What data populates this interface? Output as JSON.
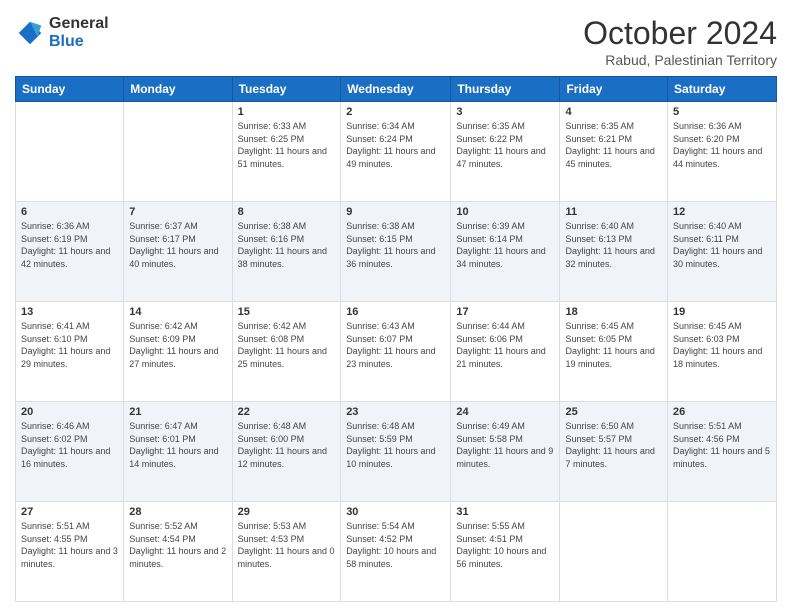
{
  "logo": {
    "general": "General",
    "blue": "Blue"
  },
  "header": {
    "month": "October 2024",
    "location": "Rabud, Palestinian Territory"
  },
  "weekdays": [
    "Sunday",
    "Monday",
    "Tuesday",
    "Wednesday",
    "Thursday",
    "Friday",
    "Saturday"
  ],
  "weeks": [
    [
      {
        "day": "",
        "sunrise": "",
        "sunset": "",
        "daylight": ""
      },
      {
        "day": "",
        "sunrise": "",
        "sunset": "",
        "daylight": ""
      },
      {
        "day": "1",
        "sunrise": "Sunrise: 6:33 AM",
        "sunset": "Sunset: 6:25 PM",
        "daylight": "Daylight: 11 hours and 51 minutes."
      },
      {
        "day": "2",
        "sunrise": "Sunrise: 6:34 AM",
        "sunset": "Sunset: 6:24 PM",
        "daylight": "Daylight: 11 hours and 49 minutes."
      },
      {
        "day": "3",
        "sunrise": "Sunrise: 6:35 AM",
        "sunset": "Sunset: 6:22 PM",
        "daylight": "Daylight: 11 hours and 47 minutes."
      },
      {
        "day": "4",
        "sunrise": "Sunrise: 6:35 AM",
        "sunset": "Sunset: 6:21 PM",
        "daylight": "Daylight: 11 hours and 45 minutes."
      },
      {
        "day": "5",
        "sunrise": "Sunrise: 6:36 AM",
        "sunset": "Sunset: 6:20 PM",
        "daylight": "Daylight: 11 hours and 44 minutes."
      }
    ],
    [
      {
        "day": "6",
        "sunrise": "Sunrise: 6:36 AM",
        "sunset": "Sunset: 6:19 PM",
        "daylight": "Daylight: 11 hours and 42 minutes."
      },
      {
        "day": "7",
        "sunrise": "Sunrise: 6:37 AM",
        "sunset": "Sunset: 6:17 PM",
        "daylight": "Daylight: 11 hours and 40 minutes."
      },
      {
        "day": "8",
        "sunrise": "Sunrise: 6:38 AM",
        "sunset": "Sunset: 6:16 PM",
        "daylight": "Daylight: 11 hours and 38 minutes."
      },
      {
        "day": "9",
        "sunrise": "Sunrise: 6:38 AM",
        "sunset": "Sunset: 6:15 PM",
        "daylight": "Daylight: 11 hours and 36 minutes."
      },
      {
        "day": "10",
        "sunrise": "Sunrise: 6:39 AM",
        "sunset": "Sunset: 6:14 PM",
        "daylight": "Daylight: 11 hours and 34 minutes."
      },
      {
        "day": "11",
        "sunrise": "Sunrise: 6:40 AM",
        "sunset": "Sunset: 6:13 PM",
        "daylight": "Daylight: 11 hours and 32 minutes."
      },
      {
        "day": "12",
        "sunrise": "Sunrise: 6:40 AM",
        "sunset": "Sunset: 6:11 PM",
        "daylight": "Daylight: 11 hours and 30 minutes."
      }
    ],
    [
      {
        "day": "13",
        "sunrise": "Sunrise: 6:41 AM",
        "sunset": "Sunset: 6:10 PM",
        "daylight": "Daylight: 11 hours and 29 minutes."
      },
      {
        "day": "14",
        "sunrise": "Sunrise: 6:42 AM",
        "sunset": "Sunset: 6:09 PM",
        "daylight": "Daylight: 11 hours and 27 minutes."
      },
      {
        "day": "15",
        "sunrise": "Sunrise: 6:42 AM",
        "sunset": "Sunset: 6:08 PM",
        "daylight": "Daylight: 11 hours and 25 minutes."
      },
      {
        "day": "16",
        "sunrise": "Sunrise: 6:43 AM",
        "sunset": "Sunset: 6:07 PM",
        "daylight": "Daylight: 11 hours and 23 minutes."
      },
      {
        "day": "17",
        "sunrise": "Sunrise: 6:44 AM",
        "sunset": "Sunset: 6:06 PM",
        "daylight": "Daylight: 11 hours and 21 minutes."
      },
      {
        "day": "18",
        "sunrise": "Sunrise: 6:45 AM",
        "sunset": "Sunset: 6:05 PM",
        "daylight": "Daylight: 11 hours and 19 minutes."
      },
      {
        "day": "19",
        "sunrise": "Sunrise: 6:45 AM",
        "sunset": "Sunset: 6:03 PM",
        "daylight": "Daylight: 11 hours and 18 minutes."
      }
    ],
    [
      {
        "day": "20",
        "sunrise": "Sunrise: 6:46 AM",
        "sunset": "Sunset: 6:02 PM",
        "daylight": "Daylight: 11 hours and 16 minutes."
      },
      {
        "day": "21",
        "sunrise": "Sunrise: 6:47 AM",
        "sunset": "Sunset: 6:01 PM",
        "daylight": "Daylight: 11 hours and 14 minutes."
      },
      {
        "day": "22",
        "sunrise": "Sunrise: 6:48 AM",
        "sunset": "Sunset: 6:00 PM",
        "daylight": "Daylight: 11 hours and 12 minutes."
      },
      {
        "day": "23",
        "sunrise": "Sunrise: 6:48 AM",
        "sunset": "Sunset: 5:59 PM",
        "daylight": "Daylight: 11 hours and 10 minutes."
      },
      {
        "day": "24",
        "sunrise": "Sunrise: 6:49 AM",
        "sunset": "Sunset: 5:58 PM",
        "daylight": "Daylight: 11 hours and 9 minutes."
      },
      {
        "day": "25",
        "sunrise": "Sunrise: 6:50 AM",
        "sunset": "Sunset: 5:57 PM",
        "daylight": "Daylight: 11 hours and 7 minutes."
      },
      {
        "day": "26",
        "sunrise": "Sunrise: 5:51 AM",
        "sunset": "Sunset: 4:56 PM",
        "daylight": "Daylight: 11 hours and 5 minutes."
      }
    ],
    [
      {
        "day": "27",
        "sunrise": "Sunrise: 5:51 AM",
        "sunset": "Sunset: 4:55 PM",
        "daylight": "Daylight: 11 hours and 3 minutes."
      },
      {
        "day": "28",
        "sunrise": "Sunrise: 5:52 AM",
        "sunset": "Sunset: 4:54 PM",
        "daylight": "Daylight: 11 hours and 2 minutes."
      },
      {
        "day": "29",
        "sunrise": "Sunrise: 5:53 AM",
        "sunset": "Sunset: 4:53 PM",
        "daylight": "Daylight: 11 hours and 0 minutes."
      },
      {
        "day": "30",
        "sunrise": "Sunrise: 5:54 AM",
        "sunset": "Sunset: 4:52 PM",
        "daylight": "Daylight: 10 hours and 58 minutes."
      },
      {
        "day": "31",
        "sunrise": "Sunrise: 5:55 AM",
        "sunset": "Sunset: 4:51 PM",
        "daylight": "Daylight: 10 hours and 56 minutes."
      },
      {
        "day": "",
        "sunrise": "",
        "sunset": "",
        "daylight": ""
      },
      {
        "day": "",
        "sunrise": "",
        "sunset": "",
        "daylight": ""
      }
    ]
  ]
}
